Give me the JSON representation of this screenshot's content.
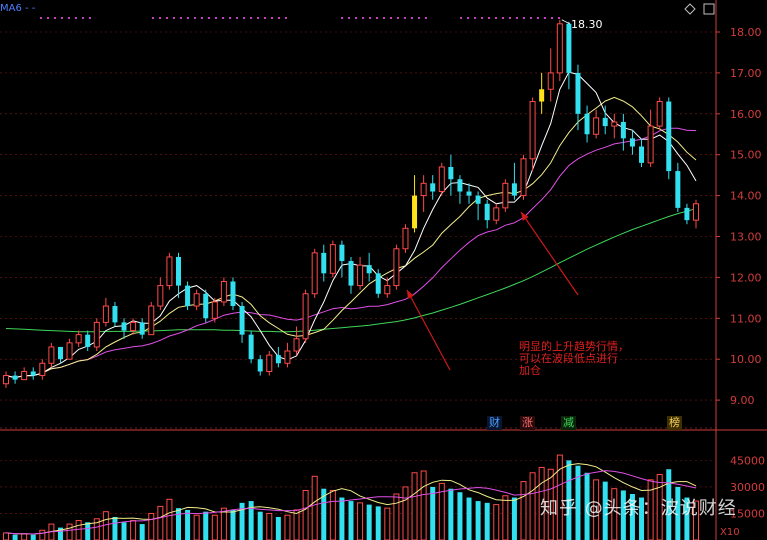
{
  "indicator_label": "MA6 - -",
  "high_label": "18.30",
  "annotation": {
    "lines": [
      "明显的上升趋势行情，",
      "可以在波段低点进行",
      "加仓"
    ]
  },
  "event_tags": [
    {
      "text": "财",
      "color": "#4aa0ff",
      "bg": "#0a1530"
    },
    {
      "text": "涨",
      "color": "#ff6b6b",
      "bg": "#2a0a0a"
    },
    {
      "text": "减",
      "color": "#3fd65a",
      "bg": "#0a250a"
    },
    {
      "text": "榜",
      "color": "#f0d060",
      "bg": "#403000"
    }
  ],
  "watermark": "知乎 @头条：波说财经",
  "volume_multiplier": "X10",
  "colors": {
    "up": "#ff4a4a",
    "down": "#33e0f0",
    "limit_up": "#ffe21a",
    "ma5": "#ffffff",
    "ma10": "#f2ee8a",
    "ma20": "#e050e8",
    "ma60": "#3fd65a",
    "axis": "#d23c3c",
    "arrow": "#cc1a1a"
  },
  "chart_data": [
    {
      "type": "candlestick",
      "title": "",
      "y_ticks": [
        9.0,
        10.0,
        11.0,
        12.0,
        13.0,
        14.0,
        15.0,
        16.0,
        17.0,
        18.0
      ],
      "ylim": [
        8.6,
        18.45
      ],
      "candles": [
        [
          9.4,
          9.6,
          9.3,
          9.7
        ],
        [
          9.6,
          9.5,
          9.4,
          9.7
        ],
        [
          9.5,
          9.7,
          9.5,
          9.8
        ],
        [
          9.7,
          9.6,
          9.5,
          9.8
        ],
        [
          9.6,
          9.9,
          9.5,
          10.0
        ],
        [
          9.9,
          10.3,
          9.8,
          10.4
        ],
        [
          10.3,
          10.0,
          9.9,
          10.3
        ],
        [
          10.0,
          10.4,
          10.0,
          10.5
        ],
        [
          10.4,
          10.6,
          10.3,
          10.7
        ],
        [
          10.6,
          10.3,
          10.2,
          10.7
        ],
        [
          10.3,
          10.9,
          10.2,
          11.0
        ],
        [
          10.9,
          11.3,
          10.8,
          11.5
        ],
        [
          11.3,
          10.9,
          10.8,
          11.4
        ],
        [
          10.9,
          10.7,
          10.5,
          11.0
        ],
        [
          10.7,
          10.9,
          10.6,
          11.0
        ],
        [
          10.9,
          10.6,
          10.5,
          11.0
        ],
        [
          10.6,
          11.3,
          10.6,
          11.4
        ],
        [
          11.3,
          11.8,
          11.2,
          12.0
        ],
        [
          11.8,
          12.5,
          11.7,
          12.6
        ],
        [
          12.5,
          11.8,
          11.5,
          12.6
        ],
        [
          11.8,
          11.3,
          11.2,
          11.9
        ],
        [
          11.3,
          11.6,
          11.2,
          11.7
        ],
        [
          11.6,
          11.0,
          10.9,
          11.7
        ],
        [
          11.0,
          11.4,
          10.9,
          11.5
        ],
        [
          11.4,
          11.9,
          11.3,
          12.0
        ],
        [
          11.9,
          11.3,
          11.2,
          12.0
        ],
        [
          11.3,
          10.6,
          10.4,
          11.4
        ],
        [
          10.6,
          10.0,
          9.9,
          10.7
        ],
        [
          10.0,
          9.7,
          9.6,
          10.1
        ],
        [
          9.7,
          10.1,
          9.6,
          10.2
        ],
        [
          10.1,
          9.9,
          9.8,
          10.3
        ],
        [
          9.9,
          10.2,
          9.8,
          10.4
        ],
        [
          10.2,
          10.5,
          10.1,
          10.8
        ],
        [
          10.5,
          11.6,
          10.4,
          11.7
        ],
        [
          11.6,
          12.6,
          11.5,
          12.7
        ],
        [
          12.6,
          12.1,
          11.9,
          12.8
        ],
        [
          12.1,
          12.8,
          12.0,
          12.9
        ],
        [
          12.8,
          12.4,
          12.0,
          12.9
        ],
        [
          12.4,
          11.8,
          11.6,
          12.5
        ],
        [
          11.8,
          12.3,
          11.7,
          12.5
        ],
        [
          12.3,
          12.1,
          11.9,
          12.6
        ],
        [
          12.1,
          11.6,
          11.5,
          12.2
        ],
        [
          11.6,
          11.8,
          11.5,
          12.0
        ],
        [
          11.8,
          12.7,
          11.7,
          12.8
        ],
        [
          12.7,
          13.2,
          12.6,
          13.3
        ],
        [
          13.2,
          14.0,
          13.1,
          14.5
        ],
        [
          14.0,
          14.3,
          13.6,
          14.5
        ],
        [
          14.3,
          14.1,
          13.9,
          14.5
        ],
        [
          14.1,
          14.7,
          14.0,
          14.8
        ],
        [
          14.7,
          14.4,
          14.0,
          15.0
        ],
        [
          14.4,
          14.1,
          13.8,
          14.5
        ],
        [
          14.1,
          14.0,
          13.8,
          14.3
        ],
        [
          14.0,
          13.8,
          13.4,
          14.1
        ],
        [
          13.8,
          13.4,
          13.2,
          13.9
        ],
        [
          13.4,
          13.7,
          13.3,
          13.8
        ],
        [
          13.7,
          14.3,
          13.6,
          14.4
        ],
        [
          14.3,
          14.0,
          13.9,
          14.8
        ],
        [
          14.0,
          14.9,
          13.9,
          15.0
        ],
        [
          14.9,
          16.3,
          14.6,
          16.4
        ],
        [
          16.3,
          16.6,
          16.0,
          17.0
        ],
        [
          16.6,
          17.0,
          16.3,
          17.6
        ],
        [
          17.0,
          18.2,
          16.8,
          18.3
        ],
        [
          18.2,
          17.0,
          16.6,
          18.25
        ],
        [
          17.0,
          16.0,
          15.6,
          17.2
        ],
        [
          16.0,
          15.5,
          15.3,
          16.2
        ],
        [
          15.5,
          15.9,
          15.4,
          16.1
        ],
        [
          15.9,
          15.7,
          15.5,
          16.2
        ],
        [
          15.7,
          15.8,
          15.4,
          16.0
        ],
        [
          15.8,
          15.4,
          15.1,
          16.0
        ],
        [
          15.4,
          15.2,
          15.0,
          15.6
        ],
        [
          15.2,
          14.8,
          14.7,
          15.4
        ],
        [
          14.8,
          15.7,
          14.7,
          16.1
        ],
        [
          15.7,
          16.3,
          15.6,
          16.4
        ],
        [
          16.3,
          14.6,
          14.4,
          16.4
        ],
        [
          14.6,
          13.7,
          13.6,
          14.8
        ],
        [
          13.7,
          13.4,
          13.3,
          13.8
        ],
        [
          13.4,
          13.8,
          13.2,
          13.9
        ]
      ],
      "limit_up_days": [
        45,
        59
      ],
      "ma60": [
        10.75,
        10.74,
        10.73,
        10.72,
        10.71,
        10.7,
        10.69,
        10.68,
        10.67,
        10.67,
        10.67,
        10.68,
        10.68,
        10.68,
        10.68,
        10.69,
        10.69,
        10.7,
        10.71,
        10.72,
        10.72,
        10.72,
        10.72,
        10.72,
        10.71,
        10.71,
        10.7,
        10.69,
        10.68,
        10.68,
        10.67,
        10.67,
        10.68,
        10.69,
        10.71,
        10.73,
        10.75,
        10.77,
        10.79,
        10.81,
        10.83,
        10.86,
        10.89,
        10.92,
        10.96,
        11.01,
        11.07,
        11.13,
        11.2,
        11.27,
        11.34,
        11.42,
        11.5,
        11.58,
        11.66,
        11.74,
        11.83,
        11.92,
        12.02,
        12.13,
        12.24,
        12.36,
        12.47,
        12.58,
        12.69,
        12.79,
        12.89,
        12.99,
        13.08,
        13.17,
        13.25,
        13.33,
        13.41,
        13.49,
        13.56,
        13.62,
        13.68
      ]
    },
    {
      "type": "bar",
      "title": "",
      "y_ticks": [
        15000,
        30000,
        45000
      ],
      "ylim": [
        0,
        52000
      ],
      "volumes": [
        4000,
        3000,
        3500,
        3000,
        5500,
        9000,
        7000,
        9000,
        11000,
        10000,
        12000,
        16000,
        13000,
        10000,
        11000,
        9000,
        15000,
        19000,
        23000,
        18000,
        17000,
        14000,
        16000,
        14000,
        18000,
        17000,
        21000,
        22000,
        16000,
        15000,
        13000,
        14000,
        17000,
        28000,
        36000,
        29000,
        28000,
        24000,
        22000,
        21000,
        20000,
        19000,
        18000,
        26000,
        30000,
        38000,
        39000,
        30000,
        32000,
        29000,
        27000,
        24000,
        22000,
        21000,
        20000,
        25000,
        24000,
        33000,
        38000,
        41000,
        40000,
        48000,
        45000,
        42000,
        38000,
        34000,
        33000,
        29000,
        28000,
        26000,
        24000,
        34000,
        37000,
        40000,
        30000,
        24000,
        22000
      ]
    }
  ]
}
